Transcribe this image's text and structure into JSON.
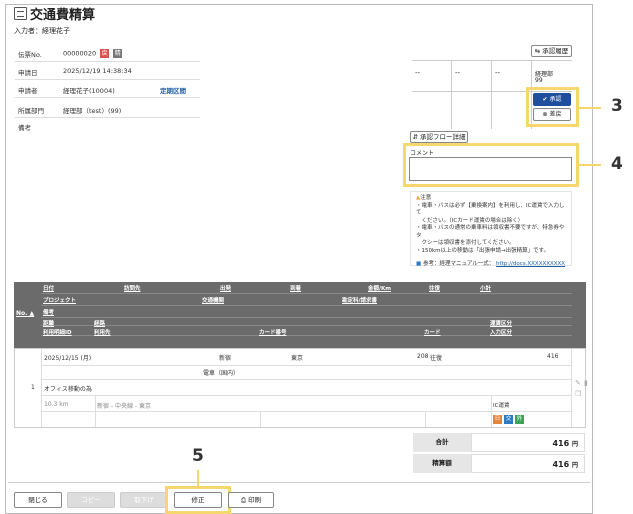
{
  "title": "交通費精算",
  "entrant": "入力者：経理花子",
  "info": {
    "slip_no_label": "伝票No.",
    "slip_no": "00000020",
    "badge_ret": "戻",
    "badge_ret_color": "#d9534f",
    "badge_other": "精",
    "badge_other_color": "#777777",
    "apply_date_label": "申請日",
    "apply_date": "2025/12/19 14:38:34",
    "applicant_label": "申請者",
    "applicant": "経理花子(10004)",
    "teiki_link": "定期区間",
    "dept_label": "所属部門",
    "dept": "経理部（test）(99)",
    "remarks_label": "備考"
  },
  "approval": {
    "history_button": "承認履歴",
    "cells": [
      "--",
      "--",
      "--"
    ],
    "dept": "経理部",
    "dept_code": "99",
    "approve_button": "承認",
    "reject_button": "差戻",
    "flow_detail_button": "承認フロー詳細",
    "comment_label": "コメント"
  },
  "notes": {
    "heading": "注意",
    "lines": [
      "・電車・バスは必ず【乗換案内】を利用し、IC運賃で入力して",
      "　ください。（ICカード運賃の場合は除く）",
      "・電車・バスの通常の乗車料は領収書不要ですが、特急券やタ",
      "　クシーは領収書を添付してください。",
      "・150km以上の移動は「出張申請→出張精算」です。"
    ],
    "ref_label": "参考：経理マニュアル一式：",
    "ref_link": "http://docs.XXXXXXXXXX"
  },
  "table": {
    "no_label": "No.",
    "h1": [
      "日付",
      "訪問先",
      "出発",
      "到着",
      "金額/Km",
      "往復",
      "小計"
    ],
    "h2": [
      "プロジェクト",
      "交通機関",
      "勘定科/請求書"
    ],
    "h3": [
      "備考"
    ],
    "h4": [
      "距離",
      "経路",
      "運賃区分"
    ],
    "h5": [
      "利用明細ID",
      "利用先",
      "カード番号",
      "カード",
      "入力区分"
    ],
    "row": {
      "no": "1",
      "date": "2025/12/15 (月)",
      "from": "新宿",
      "to": "東京",
      "amount": "208",
      "roundtrip": "往復",
      "subtotal": "416",
      "transport": "電車（国内）",
      "remarks": "オフィス移動の為",
      "distance": "10.3 km",
      "route": "新宿 - 中央線 - 東京",
      "fare_type": "IC運賃",
      "badge_colors": [
        "#e8833a",
        "#2e7bc4",
        "#3aa655"
      ],
      "badges": [
        "日",
        "交",
        "外"
      ]
    }
  },
  "totals": {
    "total_label": "合計",
    "total_value": "416",
    "settle_label": "精算額",
    "settle_value": "416",
    "currency": "円"
  },
  "buttons": {
    "close": "閉じる",
    "copy": "コピー",
    "withdraw": "取下げ",
    "modify": "修正",
    "print": "印刷"
  },
  "callouts": {
    "c3": "3",
    "c4": "4",
    "c5": "5"
  }
}
